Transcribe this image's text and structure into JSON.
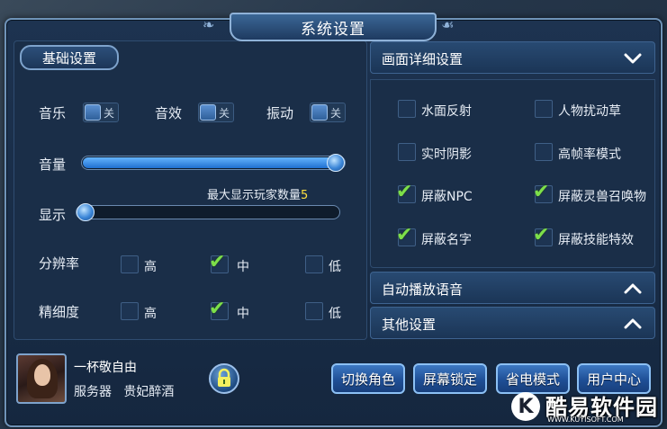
{
  "dialog": {
    "title": "系统设置"
  },
  "basic": {
    "tab_label": "基础设置",
    "music": {
      "label": "音乐",
      "state": "关"
    },
    "sfx": {
      "label": "音效",
      "state": "关"
    },
    "vibrate": {
      "label": "振动",
      "state": "关"
    },
    "volume": {
      "label": "音量",
      "value_fraction": 1.0
    },
    "display": {
      "label": "显示",
      "value_fraction": 0.0,
      "max_players_label": "最大显示玩家数量",
      "max_players_value": "5"
    },
    "resolution": {
      "label": "分辨率",
      "options": [
        "高",
        "中",
        "低"
      ],
      "selected": "中"
    },
    "detail": {
      "label": "精细度",
      "options": [
        "高",
        "中",
        "低"
      ],
      "selected": "中"
    }
  },
  "graphics": {
    "header": "画面详细设置",
    "options": [
      {
        "label": "水面反射",
        "checked": false
      },
      {
        "label": "人物扰动草",
        "checked": false
      },
      {
        "label": "实时阴影",
        "checked": false
      },
      {
        "label": "高帧率模式",
        "checked": false
      },
      {
        "label": "屏蔽NPC",
        "checked": true
      },
      {
        "label": "屏蔽灵兽召唤物",
        "checked": true
      },
      {
        "label": "屏蔽名字",
        "checked": true
      },
      {
        "label": "屏蔽技能特效",
        "checked": true
      }
    ]
  },
  "auto_voice": {
    "header": "自动播放语音"
  },
  "other": {
    "header": "其他设置"
  },
  "player": {
    "name": "一杯敬自由",
    "server_label": "服务器",
    "server_name": "贵妃醉酒"
  },
  "buttons": {
    "switch_role": "切换角色",
    "screen_lock": "屏幕锁定",
    "power_save": "省电模式",
    "user_center": "用户中心"
  },
  "watermark": {
    "letter": "K",
    "text": "酷易软件园",
    "url": "WWW.KUYISOFT.COM"
  },
  "colors": {
    "accent": "#2f7be0",
    "check": "#7de04a",
    "highlight": "#ffe040"
  }
}
